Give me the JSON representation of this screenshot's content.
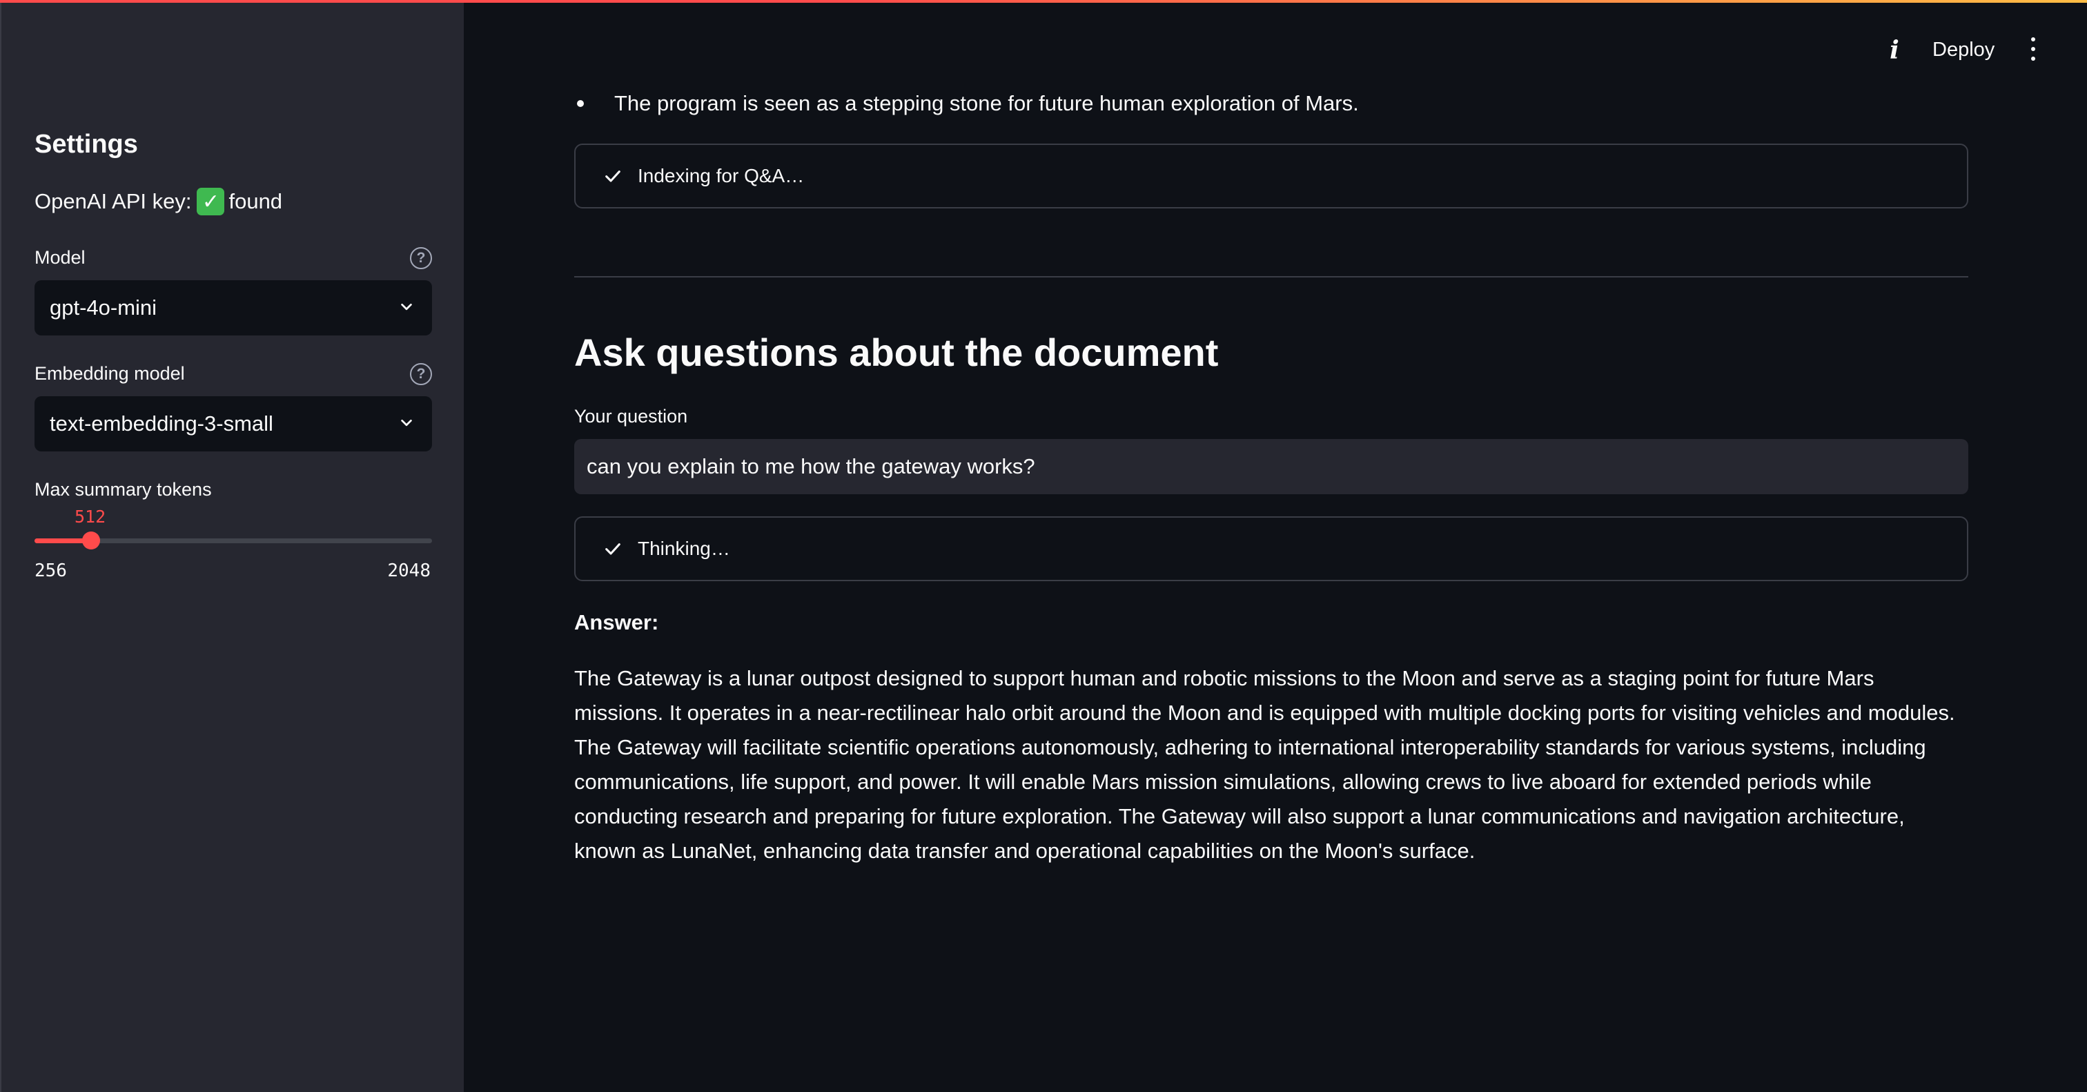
{
  "sidebar": {
    "title": "Settings",
    "api_key_label": "OpenAI API key:",
    "api_key_status_icon": "✓",
    "api_key_status": "found",
    "model": {
      "label": "Model",
      "selected": "gpt-4o-mini",
      "help_icon": "?"
    },
    "embedding_model": {
      "label": "Embedding model",
      "selected": "text-embedding-3-small",
      "help_icon": "?"
    },
    "max_summary_tokens": {
      "label": "Max summary tokens",
      "value": "512",
      "min": "256",
      "max": "2048"
    }
  },
  "topbar": {
    "info_icon": "i",
    "deploy_label": "Deploy",
    "menu_icon": "more-vertical-icon"
  },
  "main": {
    "bullet_text": "The program is seen as a stepping stone for future human exploration of Mars.",
    "indexing_status": "Indexing for Q&A…",
    "heading": "Ask questions about the document",
    "question_label": "Your question",
    "question_value": "can you explain to me how the gateway works?",
    "thinking_status": "Thinking…",
    "answer_label": "Answer:",
    "answer_text": "The Gateway is a lunar outpost designed to support human and robotic missions to the Moon and serve as a staging point for future Mars missions. It operates in a near-rectilinear halo orbit around the Moon and is equipped with multiple docking ports for visiting vehicles and modules. The Gateway will facilitate scientific operations autonomously, adhering to international interoperability standards for various systems, including communications, life support, and power. It will enable Mars mission simulations, allowing crews to live aboard for extended periods while conducting research and preparing for future exploration. The Gateway will also support a lunar communications and navigation architecture, known as LunaNet, enhancing data transfer and operational capabilities on the Moon's surface."
  },
  "colors": {
    "accent": "#ff4b4b",
    "sidebar_bg": "#262730",
    "main_bg": "#0e1117",
    "text": "#fafafa"
  }
}
